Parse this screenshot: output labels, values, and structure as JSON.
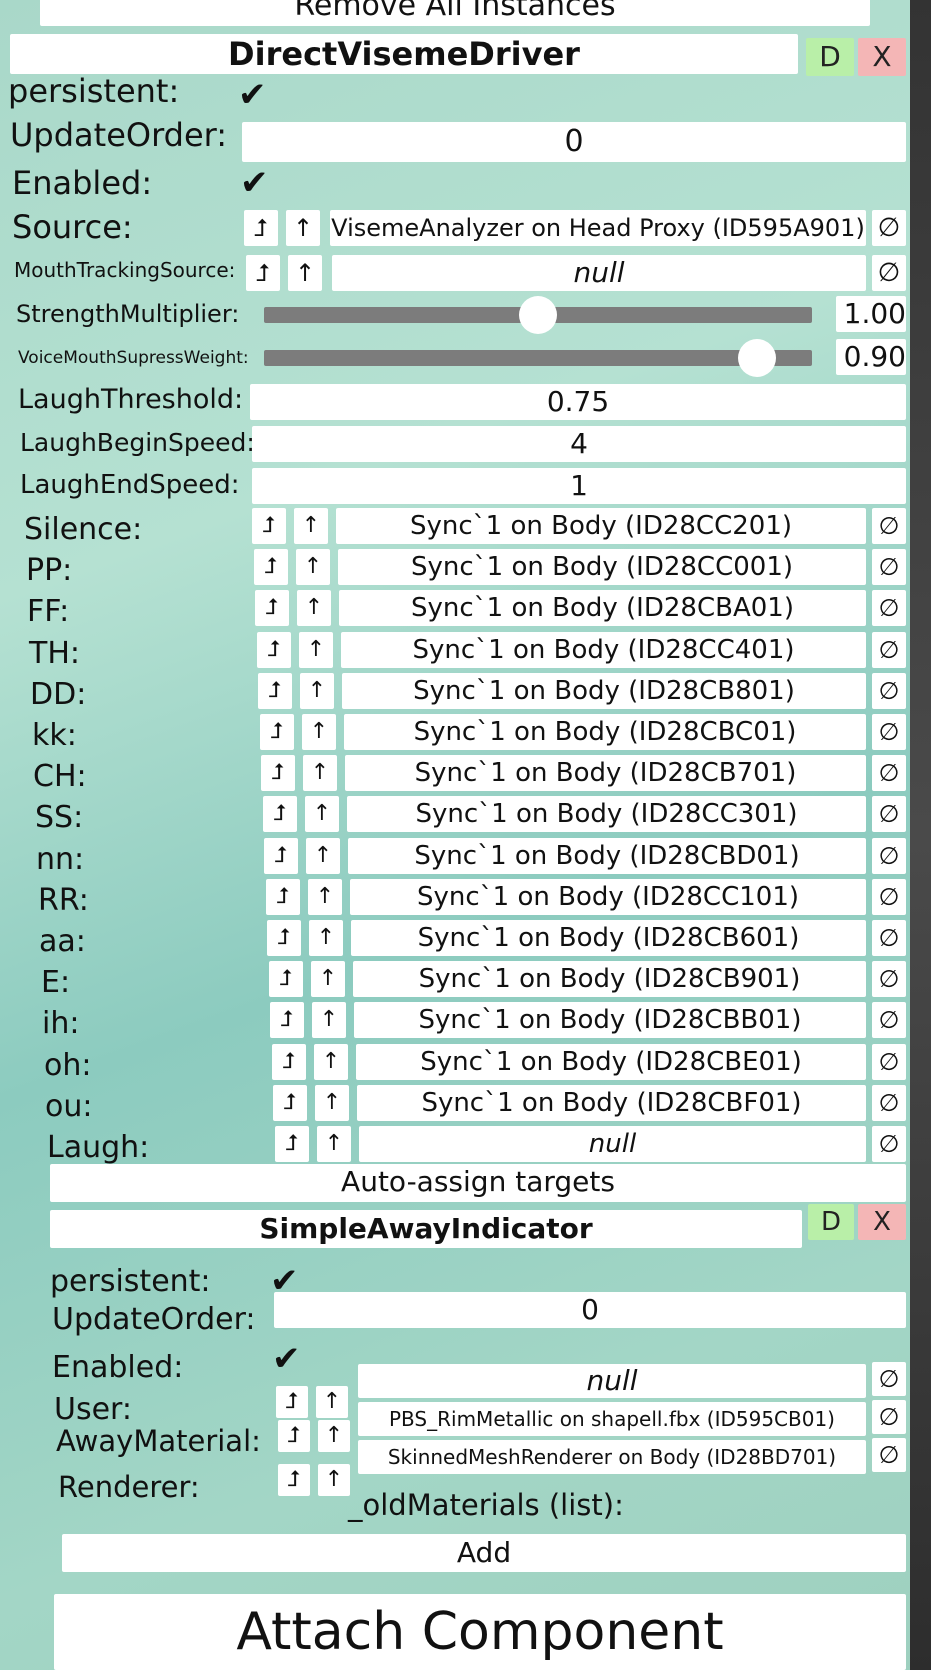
{
  "top": {
    "remove_all": "Remove All Instances"
  },
  "comp1": {
    "title": "DirectVisemeDriver",
    "d": "D",
    "x": "X",
    "persistent_label": "persistent:",
    "update_label": "UpdateOrder:",
    "update_value": "0",
    "enabled_label": "Enabled:",
    "source_label": "Source:",
    "source_value": "VisemeAnalyzer on Head Proxy (ID595A901)",
    "mouth_label": "MouthTrackingSource:",
    "mouth_value": "null",
    "strength_label": "StrengthMultiplier:",
    "strength_value": "1.00",
    "strength_fraction": 0.5,
    "voice_label": "VoiceMouthSupressWeight:",
    "voice_value": "0.90",
    "voice_fraction": 0.9,
    "laugh_threshold_label": "LaughThreshold:",
    "laugh_threshold_value": "0.75",
    "laugh_begin_label": "LaughBeginSpeed:",
    "laugh_begin_value": "4",
    "laugh_end_label": "LaughEndSpeed:",
    "laugh_end_value": "1",
    "visemes": [
      {
        "label": "Silence:",
        "value": "Sync`1 on Body (ID28CC201)"
      },
      {
        "label": "PP:",
        "value": "Sync`1 on Body (ID28CC001)"
      },
      {
        "label": "FF:",
        "value": "Sync`1 on Body (ID28CBA01)"
      },
      {
        "label": "TH:",
        "value": "Sync`1 on Body (ID28CC401)"
      },
      {
        "label": "DD:",
        "value": "Sync`1 on Body (ID28CB801)"
      },
      {
        "label": "kk:",
        "value": "Sync`1 on Body (ID28CBC01)"
      },
      {
        "label": "CH:",
        "value": "Sync`1 on Body (ID28CB701)"
      },
      {
        "label": "SS:",
        "value": "Sync`1 on Body (ID28CC301)"
      },
      {
        "label": "nn:",
        "value": "Sync`1 on Body (ID28CBD01)"
      },
      {
        "label": "RR:",
        "value": "Sync`1 on Body (ID28CC101)"
      },
      {
        "label": "aa:",
        "value": "Sync`1 on Body (ID28CB601)"
      },
      {
        "label": "E:",
        "value": "Sync`1 on Body (ID28CB901)"
      },
      {
        "label": "ih:",
        "value": "Sync`1 on Body (ID28CBB01)"
      },
      {
        "label": "oh:",
        "value": "Sync`1 on Body (ID28CBE01)"
      },
      {
        "label": "ou:",
        "value": "Sync`1 on Body (ID28CBF01)"
      },
      {
        "label": "Laugh:",
        "value": "null"
      }
    ],
    "auto_assign": "Auto-assign targets"
  },
  "comp2": {
    "title": "SimpleAwayIndicator",
    "d": "D",
    "x": "X",
    "persistent_label": "persistent:",
    "update_label": "UpdateOrder:",
    "update_value": "0",
    "enabled_label": "Enabled:",
    "user_label": "User:",
    "user_value": "null",
    "away_label": "AwayMaterial:",
    "away_value": "PBS_RimMetallic on shapell.fbx (ID595CB01)",
    "renderer_label": "Renderer:",
    "renderer_value": "SkinnedMeshRenderer on Body (ID28BD701)",
    "old_materials": "_oldMaterials (list):",
    "add": "Add"
  },
  "attach": "Attach Component",
  "icons": {
    "check": "✔",
    "jump": "⮥",
    "up": "↑",
    "null": "∅"
  }
}
